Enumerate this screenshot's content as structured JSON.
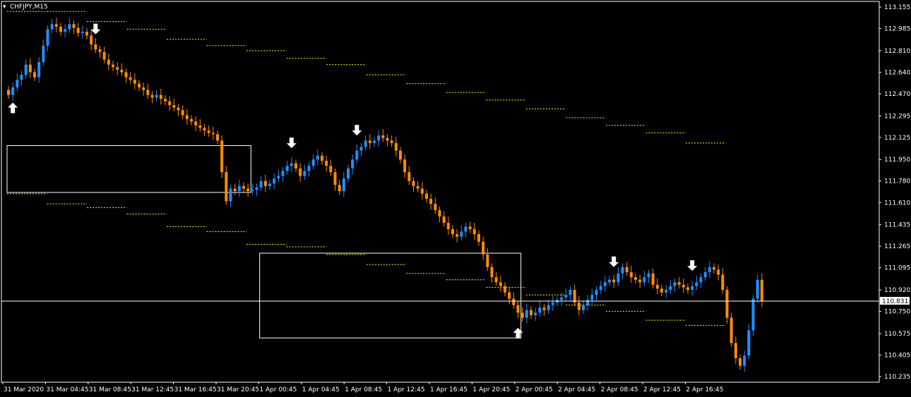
{
  "chart_data": {
    "type": "candlestick",
    "symbol_label": "CHFJPY,M15",
    "menu_icon": "triangle-down-icon",
    "current_price_label": "110.831",
    "y_ticks": [
      "113.155",
      "112.985",
      "112.810",
      "112.640",
      "112.470",
      "112.295",
      "112.125",
      "111.950",
      "111.780",
      "111.610",
      "111.435",
      "111.265",
      "111.095",
      "110.920",
      "110.750",
      "110.575",
      "110.405",
      "110.235"
    ],
    "x_ticks": [
      "31 Mar 2020",
      "31 Mar 04:45",
      "31 Mar 08:45",
      "31 Mar 12:45",
      "31 Mar 16:45",
      "31 Mar 20:45",
      "1 Apr 00:45",
      "1 Apr 04:45",
      "1 Apr 08:45",
      "1 Apr 12:45",
      "1 Apr 16:45",
      "1 Apr 20:45",
      "2 Apr 00:45",
      "2 Apr 04:45",
      "2 Apr 08:45",
      "2 Apr 12:45",
      "2 Apr 16:45"
    ],
    "close_series": [
      112.46,
      112.52,
      112.58,
      112.62,
      112.7,
      112.64,
      112.6,
      112.72,
      112.85,
      112.98,
      113.02,
      113.0,
      112.96,
      112.98,
      113.02,
      112.99,
      112.95,
      112.96,
      112.93,
      112.86,
      112.82,
      112.8,
      112.74,
      112.7,
      112.68,
      112.66,
      112.64,
      112.6,
      112.58,
      112.55,
      112.52,
      112.5,
      112.46,
      112.44,
      112.46,
      112.43,
      112.41,
      112.38,
      112.36,
      112.34,
      112.3,
      112.27,
      112.25,
      112.22,
      112.2,
      112.18,
      112.16,
      112.15,
      112.1,
      111.85,
      111.62,
      111.72,
      111.7,
      111.74,
      111.72,
      111.7,
      111.71,
      111.73,
      111.78,
      111.74,
      111.76,
      111.8,
      111.82,
      111.86,
      111.9,
      111.92,
      111.88,
      111.82,
      111.86,
      111.9,
      111.95,
      111.98,
      111.94,
      111.9,
      111.85,
      111.75,
      111.7,
      111.8,
      111.88,
      111.95,
      112.02,
      112.05,
      112.1,
      112.08,
      112.1,
      112.14,
      112.12,
      112.1,
      112.08,
      112.02,
      111.95,
      111.85,
      111.78,
      111.74,
      111.72,
      111.68,
      111.64,
      111.6,
      111.55,
      111.5,
      111.45,
      111.4,
      111.36,
      111.34,
      111.38,
      111.42,
      111.4,
      111.36,
      111.3,
      111.2,
      111.1,
      111.02,
      110.98,
      110.95,
      110.9,
      110.85,
      110.8,
      110.74,
      110.7,
      110.76,
      110.72,
      110.74,
      110.78,
      110.76,
      110.8,
      110.82,
      110.84,
      110.86,
      110.88,
      110.92,
      110.82,
      110.76,
      110.8,
      110.84,
      110.88,
      110.92,
      110.95,
      110.98,
      111.0,
      110.98,
      111.05,
      111.1,
      111.06,
      111.02,
      111.0,
      110.98,
      111.02,
      111.05,
      110.96,
      110.93,
      110.9,
      110.92,
      110.95,
      110.98,
      110.96,
      110.94,
      110.92,
      110.95,
      110.98,
      111.02,
      111.06,
      111.1,
      111.08,
      111.04,
      110.92,
      110.7,
      110.5,
      110.38,
      110.32,
      110.4,
      110.6,
      110.85,
      111.0,
      110.83
    ],
    "current_price": 110.831,
    "y_range": [
      110.235,
      113.155
    ],
    "colors": {
      "bullish": "#1e90ff",
      "bearish": "#ff8c00",
      "axis_text": "#ffffff",
      "grid_line": "#ffffff",
      "resistance": "#ffff00",
      "pivot": "#ff3333",
      "signal_arrow": "#ffffff",
      "target": "#00aa00"
    },
    "levels": [
      {
        "kind": "box",
        "x_from": 0,
        "x_to": 56,
        "y_from": 111.69,
        "y_to": 112.06,
        "color": "#ffffff"
      },
      {
        "kind": "box",
        "x_from": 58,
        "x_to": 118,
        "y_from": 110.54,
        "y_to": 111.21,
        "color": "#ffffff"
      },
      {
        "kind": "step",
        "values": [
          113.12,
          113.12,
          113.04,
          112.98,
          112.9,
          112.85,
          112.81,
          112.75,
          112.7,
          112.62,
          112.55,
          112.48,
          112.42,
          112.35,
          112.28,
          112.22,
          112.16,
          112.08
        ],
        "x_from": 0,
        "x_to": 165,
        "color": "#ffff00"
      },
      {
        "kind": "step",
        "values": [
          111.68,
          111.6,
          111.57,
          111.52,
          111.42,
          111.38,
          111.28,
          111.26,
          111.2,
          111.12,
          111.05,
          111.0,
          110.94,
          110.88,
          110.8,
          110.75,
          110.68,
          110.64
        ],
        "x_from": 0,
        "x_to": 165,
        "color": "#ffff00"
      }
    ],
    "signals": [
      {
        "index": 1,
        "direction": "up"
      },
      {
        "index": 20,
        "direction": "down"
      },
      {
        "index": 65,
        "direction": "down"
      },
      {
        "index": 80,
        "direction": "down"
      },
      {
        "index": 117,
        "direction": "up"
      },
      {
        "index": 139,
        "direction": "down"
      },
      {
        "index": 157,
        "direction": "down"
      }
    ]
  }
}
